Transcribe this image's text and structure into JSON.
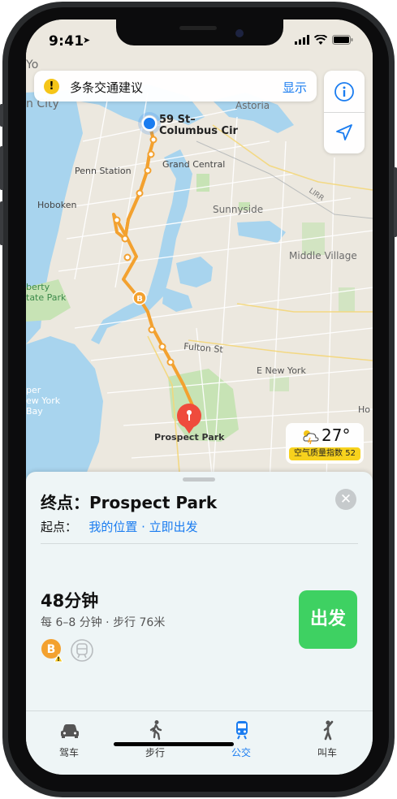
{
  "status": {
    "time": "9:41"
  },
  "banner": {
    "text": "多条交通建议",
    "action": "显示"
  },
  "map": {
    "labels": {
      "york": "Yo",
      "city": "n City",
      "astoria": "Astoria",
      "start_line1": "59 St–",
      "start_line2": "Columbus Cir",
      "penn": "Penn Station",
      "grand_central": "Grand Central",
      "hoboken": "Hoboken",
      "lirr": "LIRR",
      "sunnyside": "Sunnyside",
      "middle_village": "Middle Village",
      "liberty1": "berty",
      "liberty2": "tate Park",
      "fulton": "Fulton St",
      "e_new_york": "E New York",
      "upper1": "per",
      "upper2": "ew York",
      "upper3": "Bay",
      "ho": "Ho",
      "prospect": "Prospect Park",
      "line_badge": "B"
    },
    "colors": {
      "route": "#f3a12f",
      "user": "#1a7cf0",
      "pin": "#ef4b3c",
      "water": "#a8d4ee",
      "land": "#ece8df",
      "park": "#c7e3b5"
    }
  },
  "weather": {
    "temp": "27°",
    "aqi": "空气质量指数 52"
  },
  "sheet": {
    "dest_prefix": "终点：",
    "dest_name": "Prospect Park",
    "origin_label": "起点：",
    "origin_value": "我的位置",
    "dot": " · ",
    "depart": "立即出发",
    "duration": "48分钟",
    "detail": "每 6–8 分钟 · 步行 76米",
    "line_badge": "B",
    "go_button": "出发"
  },
  "tabs": [
    {
      "label": "驾车",
      "icon": "car-icon"
    },
    {
      "label": "步行",
      "icon": "walk-icon"
    },
    {
      "label": "公交",
      "icon": "train-icon",
      "active": true
    },
    {
      "label": "叫车",
      "icon": "rideshare-icon"
    }
  ]
}
